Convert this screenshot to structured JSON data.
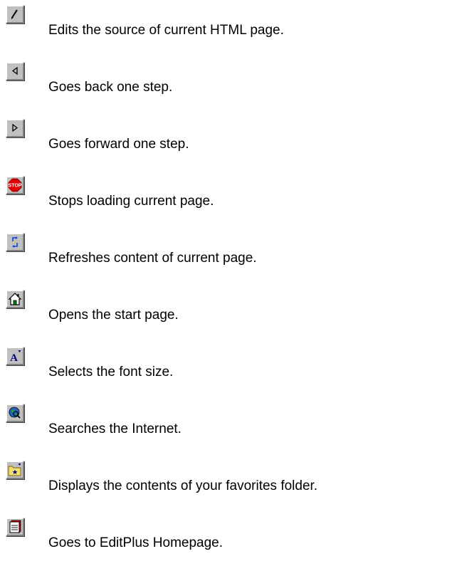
{
  "toolbar_help": {
    "items": [
      {
        "icon": "edit-pencil-icon",
        "description": "Edits the source of current HTML page."
      },
      {
        "icon": "back-arrow-icon",
        "description": "Goes back one step."
      },
      {
        "icon": "forward-arrow-icon",
        "description": "Goes forward one step."
      },
      {
        "icon": "stop-sign-icon",
        "label": "STOP",
        "description": "Stops loading current page."
      },
      {
        "icon": "refresh-icon",
        "description": "Refreshes content of current page."
      },
      {
        "icon": "home-icon",
        "description": "Opens the start page."
      },
      {
        "icon": "font-size-icon",
        "label": "A",
        "description": "Selects the font size."
      },
      {
        "icon": "search-globe-icon",
        "description": "Searches the Internet."
      },
      {
        "icon": "favorites-folder-icon",
        "description": "Displays the contents of your favorites folder."
      },
      {
        "icon": "editplus-homepage-icon",
        "description": "Goes to EditPlus Homepage."
      }
    ]
  },
  "colors": {
    "button_face": "#c0c0c0",
    "stop_red": "#e00000",
    "refresh_blue": "#1040e0",
    "home_green": "#008000",
    "font_navy": "#000080",
    "globe_blue": "#2060c0",
    "folder_yellow": "#f0e070",
    "book_red": "#d00000"
  }
}
